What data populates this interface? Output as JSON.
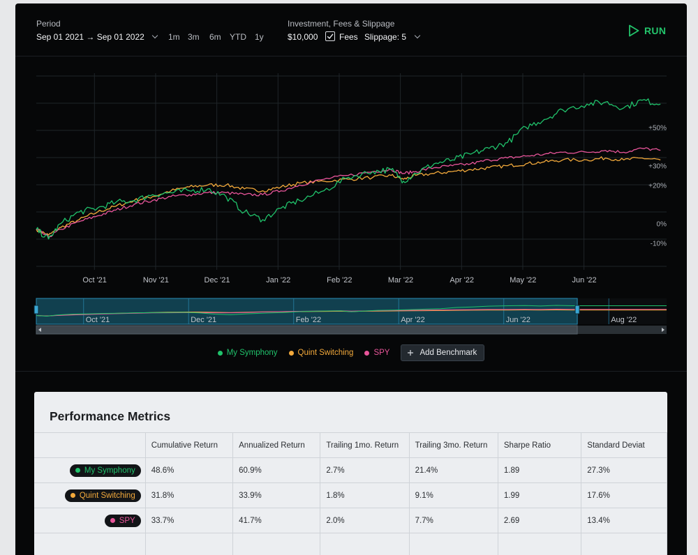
{
  "header": {
    "period_label": "Period",
    "period_value": "Sep 01 2021 → Sep 01 2022",
    "period_options": [
      "1m",
      "3m",
      "6m",
      "YTD",
      "1y"
    ],
    "investment_label": "Investment, Fees & Slippage",
    "investment_value": "$10,000",
    "fees_label": "Fees",
    "fees_checked": true,
    "slippage_value": "Slippage: 5",
    "run_label": "RUN"
  },
  "colors": {
    "my_symphony": "#20c26b",
    "quint_switching": "#f2a93b",
    "spy": "#e8559a",
    "navigator_fill": "#11404f",
    "navigator_border": "#2a8bb3"
  },
  "legend": {
    "items": [
      "My Symphony",
      "Quint Switching",
      "SPY"
    ],
    "add_benchmark_label": "Add Benchmark"
  },
  "chart_data": {
    "type": "line",
    "x_ticks": [
      "Oct '21",
      "Nov '21",
      "Dec '21",
      "Jan '22",
      "Feb '22",
      "Mar '22",
      "Apr '22",
      "May '22",
      "Jun '22"
    ],
    "y_ticks": [
      "+50%",
      "+30%",
      "+20%",
      "0%",
      "-10%"
    ],
    "y_tick_values": [
      50,
      30,
      20,
      0,
      -10
    ],
    "ylim": [
      -24,
      78
    ],
    "x_range_months": [
      0,
      10.3
    ],
    "series": [
      {
        "name": "My Symphony",
        "color_key": "my_symphony",
        "x": [
          0,
          0.2,
          0.4,
          0.7,
          1.0,
          1.3,
          1.6,
          1.9,
          2.2,
          2.5,
          2.8,
          3.1,
          3.4,
          3.7,
          4.0,
          4.3,
          4.7,
          5.1,
          5.5,
          5.8,
          6.0,
          6.2,
          6.5,
          6.8,
          7.1,
          7.4,
          7.7,
          8.0,
          8.3,
          8.6,
          9.0,
          9.3,
          9.6,
          9.9,
          10.2
        ],
        "values": [
          -3,
          -8,
          0,
          6,
          8,
          11,
          12,
          15,
          16,
          17,
          18,
          14,
          6,
          2,
          8,
          12,
          17,
          24,
          27,
          28,
          22,
          26,
          31,
          33,
          36,
          39,
          42,
          50,
          54,
          59,
          62,
          63,
          60,
          64,
          62
        ]
      },
      {
        "name": "Quint Switching",
        "color_key": "quint_switching",
        "x": [
          0,
          0.2,
          0.4,
          0.7,
          1.0,
          1.3,
          1.6,
          1.9,
          2.2,
          2.5,
          2.8,
          3.1,
          3.4,
          3.7,
          4.0,
          4.3,
          4.7,
          5.1,
          5.5,
          5.8,
          6.0,
          6.2,
          6.5,
          6.8,
          7.1,
          7.4,
          7.7,
          8.0,
          8.3,
          8.6,
          9.0,
          9.3,
          9.6,
          9.9,
          10.2
        ],
        "values": [
          -3,
          -6,
          -2,
          2,
          6,
          9,
          12,
          14,
          17,
          19,
          20,
          20,
          18,
          17,
          19,
          21,
          22,
          23,
          24,
          25,
          23,
          25,
          26,
          27,
          28,
          29,
          30,
          31,
          32,
          33,
          33,
          34,
          33,
          34,
          33
        ]
      },
      {
        "name": "SPY",
        "color_key": "spy",
        "x": [
          0,
          0.2,
          0.4,
          0.7,
          1.0,
          1.3,
          1.6,
          1.9,
          2.2,
          2.5,
          2.8,
          3.1,
          3.4,
          3.7,
          4.0,
          4.3,
          4.7,
          5.1,
          5.5,
          5.8,
          6.0,
          6.2,
          6.5,
          6.8,
          7.1,
          7.4,
          7.7,
          8.0,
          8.3,
          8.6,
          9.0,
          9.3,
          9.6,
          9.9,
          10.2
        ],
        "values": [
          -3,
          -7,
          -3,
          1,
          4,
          7,
          10,
          12,
          14,
          15,
          16,
          16,
          15,
          15,
          17,
          20,
          23,
          25,
          27,
          28,
          26,
          27,
          29,
          30,
          31,
          33,
          34,
          35,
          36,
          37,
          37,
          38,
          37,
          39,
          38
        ]
      }
    ],
    "navigator": {
      "x_ticks": [
        "Oct '21",
        "Dec '21",
        "Feb '22",
        "Apr '22",
        "Jun '22",
        "Aug '22"
      ],
      "selection_months": [
        0,
        10.3
      ],
      "total_months": 12
    }
  },
  "metrics": {
    "title": "Performance Metrics",
    "columns": [
      "Cumulative Return",
      "Annualized Return",
      "Trailing 1mo. Return",
      "Trailing 3mo. Return",
      "Sharpe Ratio",
      "Standard Deviat"
    ],
    "rows": [
      {
        "name": "My Symphony",
        "color_key": "my_symphony",
        "values": [
          "48.6%",
          "60.9%",
          "2.7%",
          "21.4%",
          "1.89",
          "27.3%"
        ]
      },
      {
        "name": "Quint Switching",
        "color_key": "quint_switching",
        "values": [
          "31.8%",
          "33.9%",
          "1.8%",
          "9.1%",
          "1.99",
          "17.6%"
        ]
      },
      {
        "name": "SPY",
        "color_key": "spy",
        "values": [
          "33.7%",
          "41.7%",
          "2.0%",
          "7.7%",
          "2.69",
          "13.4%"
        ]
      }
    ]
  }
}
